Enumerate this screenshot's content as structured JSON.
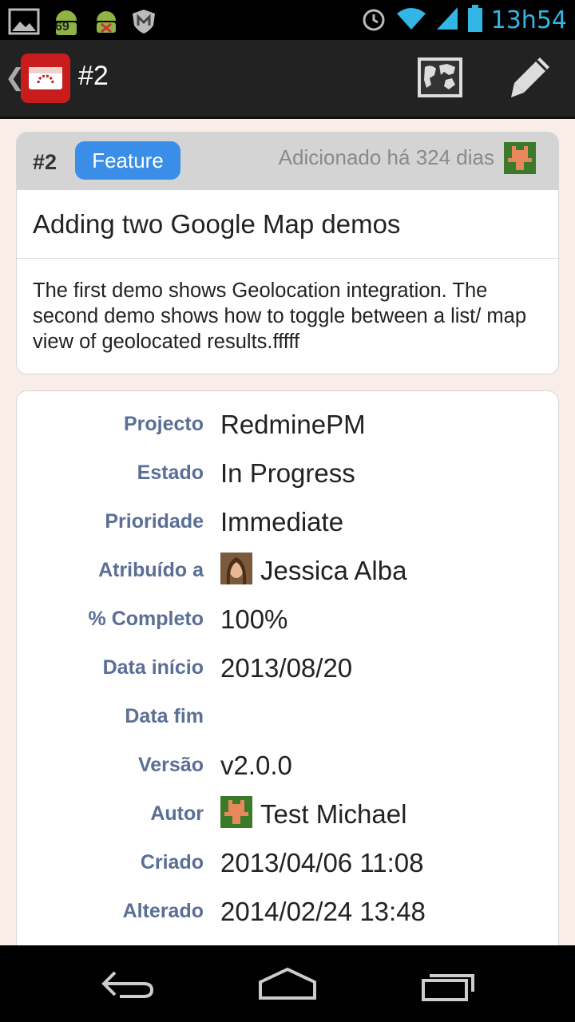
{
  "status_bar": {
    "time": "13h54",
    "notification_badge": "69",
    "icons": [
      "gallery-icon",
      "android-badge-icon",
      "android-debug-icon",
      "mcafee-icon",
      "alarm-icon",
      "wifi-icon",
      "signal-icon",
      "battery-icon"
    ]
  },
  "action_bar": {
    "title": "#2",
    "back_glyph": "❮",
    "icons": [
      "app-logo-icon",
      "map-icon",
      "edit-pencil-icon"
    ]
  },
  "issue": {
    "number": "#2",
    "tracker": "Feature",
    "added": "Adicionado há 324 dias",
    "subject": "Adding two Google Map demos",
    "description": "The first demo shows Geolocation integration. The second demo shows how to toggle between a list/ map view of geolocated results.fffff"
  },
  "details": {
    "project": {
      "label": "Projecto",
      "value": "RedminePM"
    },
    "status": {
      "label": "Estado",
      "value": "In Progress"
    },
    "priority": {
      "label": "Prioridade",
      "value": "Immediate"
    },
    "assignee": {
      "label": "Atribuído a",
      "value": "Jessica Alba"
    },
    "done": {
      "label": "% Completo",
      "value": "100%"
    },
    "start": {
      "label": "Data início",
      "value": "2013/08/20"
    },
    "due": {
      "label": "Data fim",
      "value": ""
    },
    "version": {
      "label": "Versão",
      "value": "v2.0.0"
    },
    "author": {
      "label": "Autor",
      "value": "Test Michael"
    },
    "created": {
      "label": "Criado",
      "value": "2013/04/06 11:08"
    },
    "updated": {
      "label": "Alterado",
      "value": "2014/02/24 13:48"
    }
  },
  "colors": {
    "accent_blue": "#3a8ee8",
    "label_blue": "#5a6e96",
    "background": "#f9ede8",
    "app_red": "#c91d1d",
    "status_blue": "#33b5e5"
  }
}
